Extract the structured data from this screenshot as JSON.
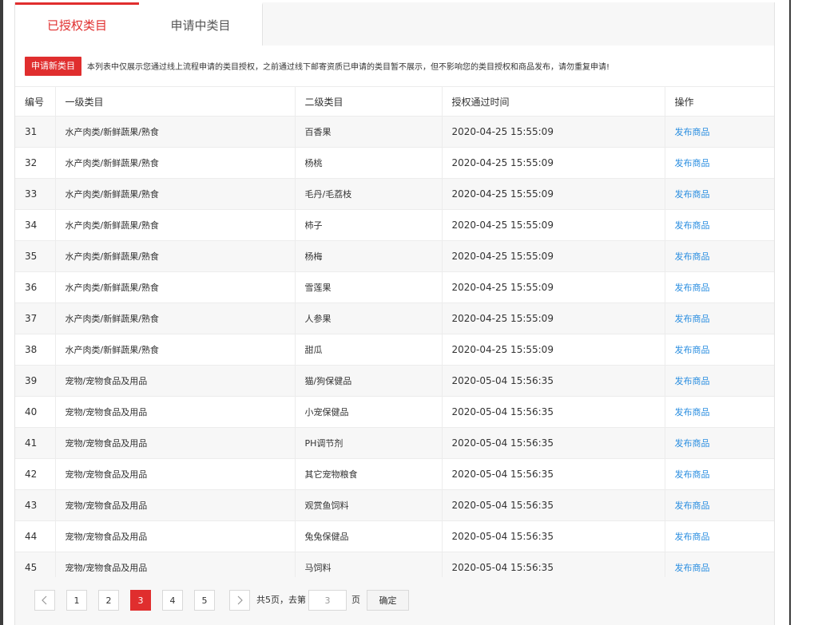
{
  "tabs": [
    {
      "label": "已授权类目",
      "active": true
    },
    {
      "label": "申请中类目",
      "active": false
    }
  ],
  "notice": {
    "button_label": "申请新类目",
    "text": "本列表中仅展示您通过线上流程申请的类目授权，之前通过线下邮寄资质已申请的类目暂不展示，但不影响您的类目授权和商品发布，请勿重复申请!"
  },
  "table": {
    "headers": [
      "编号",
      "一级类目",
      "二级类目",
      "授权通过时间",
      "操作"
    ],
    "rows": [
      {
        "id": "31",
        "level1": "水产肉类/新鲜蔬果/熟食",
        "level2": "百香果",
        "time": "2020-04-25 15:55:09",
        "action": "发布商品"
      },
      {
        "id": "32",
        "level1": "水产肉类/新鲜蔬果/熟食",
        "level2": "杨桃",
        "time": "2020-04-25 15:55:09",
        "action": "发布商品"
      },
      {
        "id": "33",
        "level1": "水产肉类/新鲜蔬果/熟食",
        "level2": "毛丹/毛荔枝",
        "time": "2020-04-25 15:55:09",
        "action": "发布商品"
      },
      {
        "id": "34",
        "level1": "水产肉类/新鲜蔬果/熟食",
        "level2": "柿子",
        "time": "2020-04-25 15:55:09",
        "action": "发布商品"
      },
      {
        "id": "35",
        "level1": "水产肉类/新鲜蔬果/熟食",
        "level2": "杨梅",
        "time": "2020-04-25 15:55:09",
        "action": "发布商品"
      },
      {
        "id": "36",
        "level1": "水产肉类/新鲜蔬果/熟食",
        "level2": "雪莲果",
        "time": "2020-04-25 15:55:09",
        "action": "发布商品"
      },
      {
        "id": "37",
        "level1": "水产肉类/新鲜蔬果/熟食",
        "level2": "人参果",
        "time": "2020-04-25 15:55:09",
        "action": "发布商品"
      },
      {
        "id": "38",
        "level1": "水产肉类/新鲜蔬果/熟食",
        "level2": "甜瓜",
        "time": "2020-04-25 15:55:09",
        "action": "发布商品"
      },
      {
        "id": "39",
        "level1": "宠物/宠物食品及用品",
        "level2": "猫/狗保健品",
        "time": "2020-05-04 15:56:35",
        "action": "发布商品"
      },
      {
        "id": "40",
        "level1": "宠物/宠物食品及用品",
        "level2": "小宠保健品",
        "time": "2020-05-04 15:56:35",
        "action": "发布商品"
      },
      {
        "id": "41",
        "level1": "宠物/宠物食品及用品",
        "level2": "PH调节剂",
        "time": "2020-05-04 15:56:35",
        "action": "发布商品"
      },
      {
        "id": "42",
        "level1": "宠物/宠物食品及用品",
        "level2": "其它宠物粮食",
        "time": "2020-05-04 15:56:35",
        "action": "发布商品"
      },
      {
        "id": "43",
        "level1": "宠物/宠物食品及用品",
        "level2": "观赏鱼饲料",
        "time": "2020-05-04 15:56:35",
        "action": "发布商品"
      },
      {
        "id": "44",
        "level1": "宠物/宠物食品及用品",
        "level2": "兔兔保健品",
        "time": "2020-05-04 15:56:35",
        "action": "发布商品"
      },
      {
        "id": "45",
        "level1": "宠物/宠物食品及用品",
        "level2": "马饲料",
        "time": "2020-05-04 15:56:35",
        "action": "发布商品"
      }
    ]
  },
  "pagination": {
    "pages": [
      "1",
      "2",
      "3",
      "4",
      "5"
    ],
    "current": "3",
    "total_label": "共5页，去第",
    "input_value": "3",
    "page_suffix": "页",
    "confirm_label": "确定"
  },
  "colors": {
    "accent": "#e02e2e",
    "link": "#2a8ee0"
  }
}
